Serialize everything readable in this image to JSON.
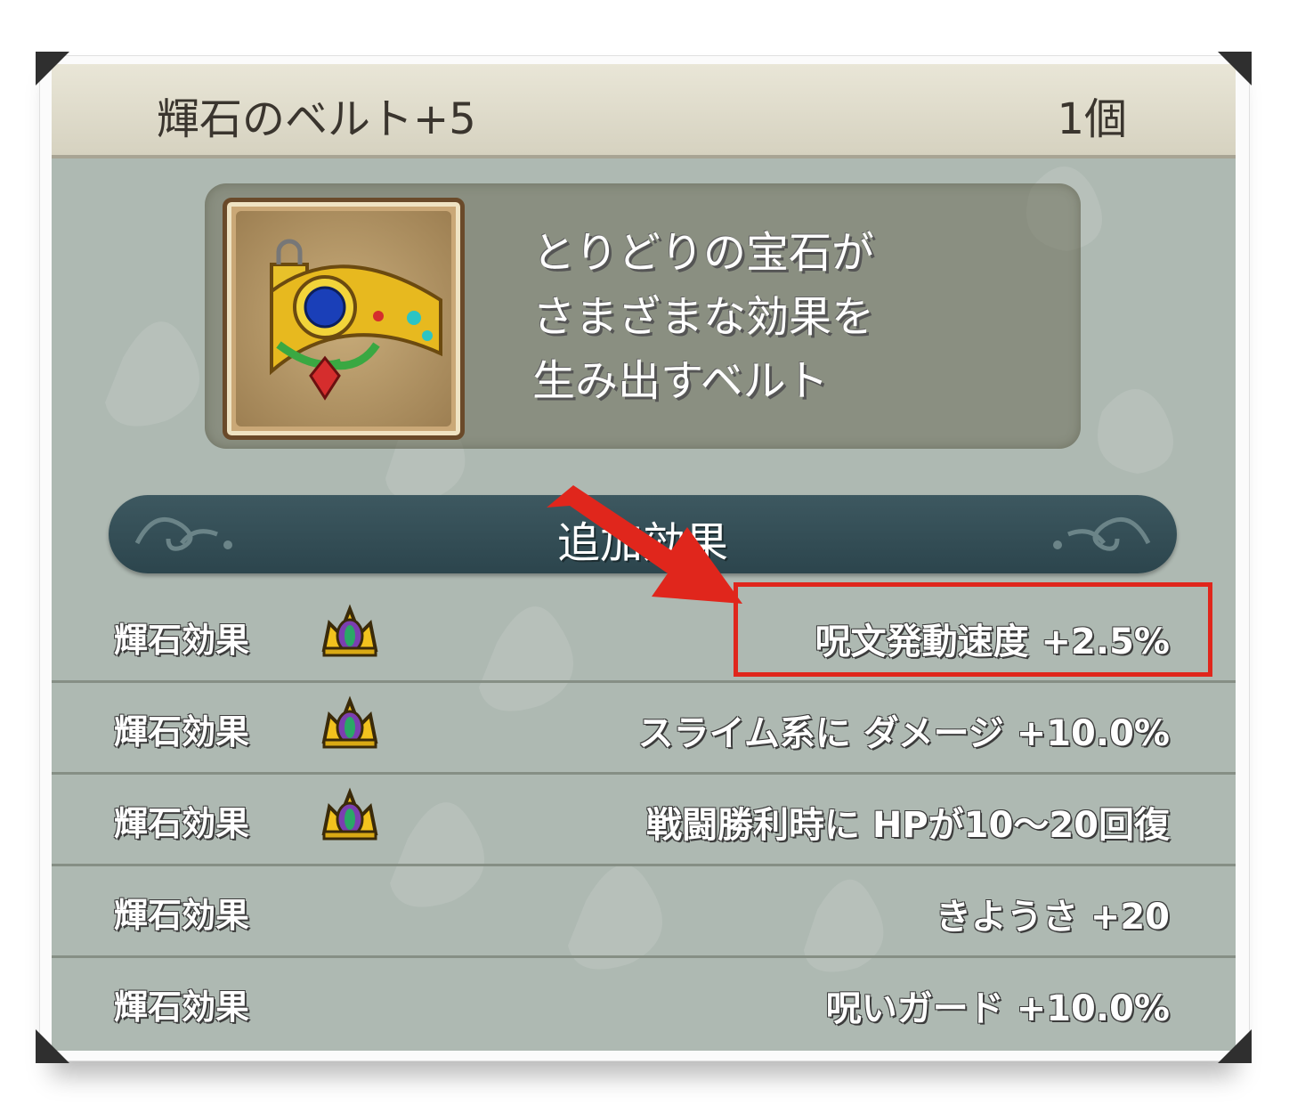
{
  "item": {
    "name": "輝石のベルト+5",
    "count": "1個"
  },
  "description": {
    "lines": [
      "とりどりの宝石が",
      "さまざまな効果を",
      "生み出すベルト"
    ]
  },
  "section": {
    "title": "追加効果"
  },
  "effects": [
    {
      "label": "輝石効果",
      "has_gem": true,
      "value": "呪文発動速度 +2.5%",
      "highlighted": true
    },
    {
      "label": "輝石効果",
      "has_gem": true,
      "value": "スライム系に ダメージ +10.0%"
    },
    {
      "label": "輝石効果",
      "has_gem": true,
      "value": "戦闘勝利時に HPが10〜20回復"
    },
    {
      "label": "輝石効果",
      "has_gem": false,
      "value": "きようさ +20"
    },
    {
      "label": "輝石効果",
      "has_gem": false,
      "value": "呪いガード +10.0%"
    }
  ],
  "icons": {
    "item_icon": "jeweled-belt-icon",
    "gem": "crown-gem-icon",
    "annotation": "red-arrow"
  },
  "colors": {
    "highlight": "#e0261c",
    "section_bar": "#2c454d",
    "panel": "#aeb9b2"
  }
}
